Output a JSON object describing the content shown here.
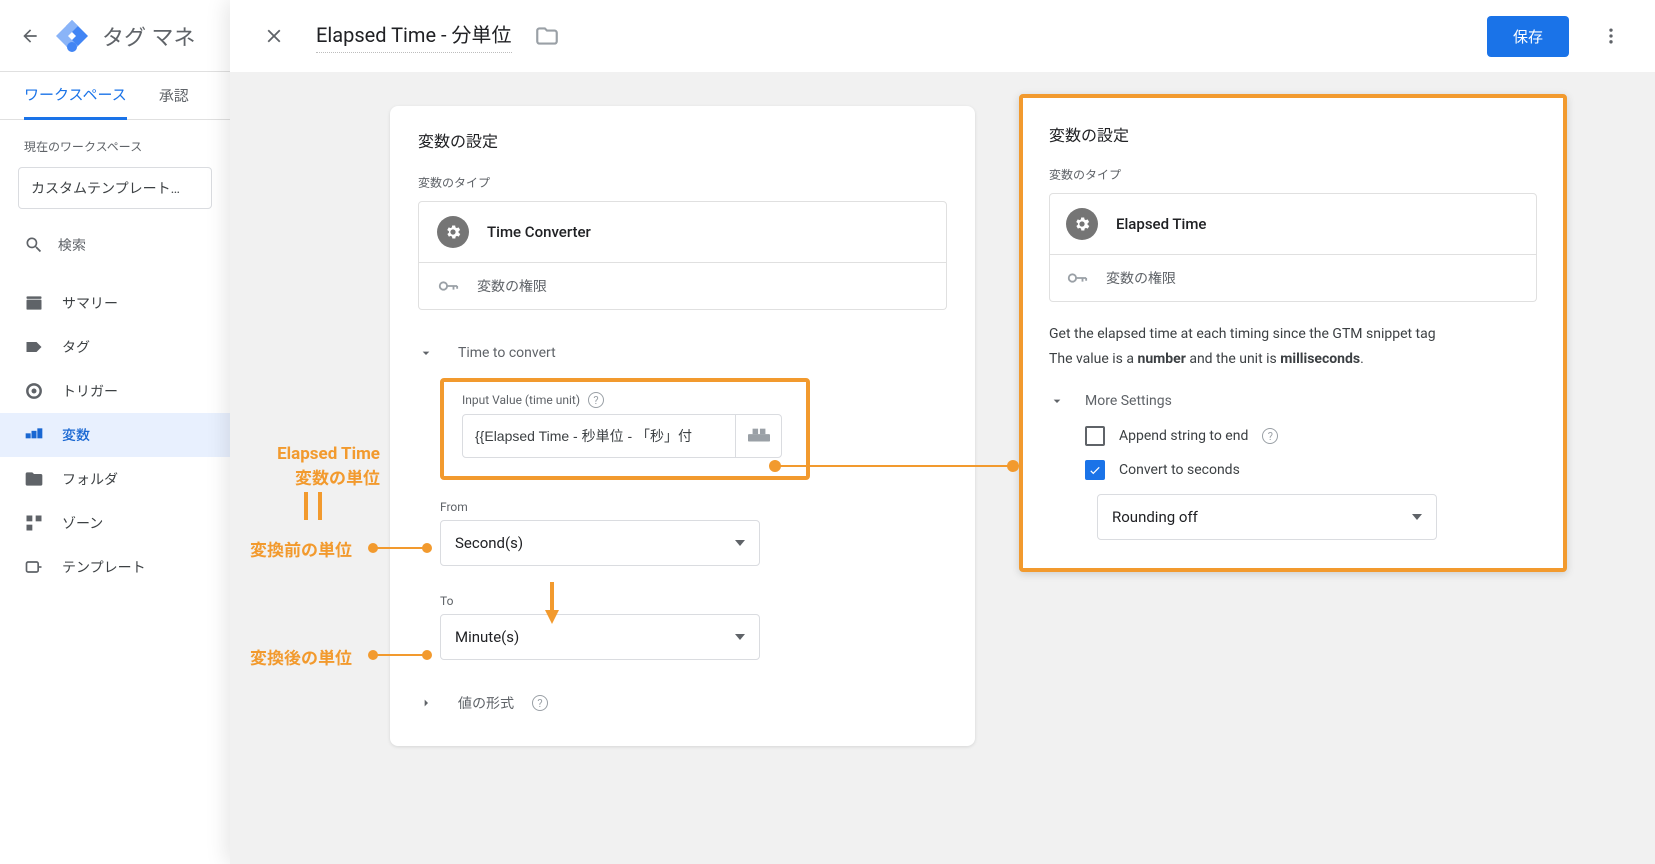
{
  "app": {
    "title": "タグ マネ"
  },
  "tabs": {
    "workspace": "ワークスペース",
    "approvals": "承認"
  },
  "workspace": {
    "label": "現在のワークスペース",
    "current": "カスタムテンプレート…"
  },
  "search": {
    "placeholder": "検索"
  },
  "nav": {
    "summary": "サマリー",
    "tags": "タグ",
    "triggers": "トリガー",
    "variables": "変数",
    "folders": "フォルダ",
    "zones": "ゾーン",
    "templates": "テンプレート"
  },
  "editor": {
    "close_tooltip": "閉じる",
    "name": "Elapsed Time - 分単位",
    "save": "保存",
    "card_title": "変数の設定",
    "type_label": "変数のタイプ",
    "type_name": "Time Converter",
    "permissions": "変数の権限",
    "time_section": "Time to convert",
    "input_label": "Input Value (time unit)",
    "input_value": "{{Elapsed Time - 秒単位 - 「秒」付",
    "from_label": "From",
    "from_value": "Second(s)",
    "to_label": "To",
    "to_value": "Minute(s)",
    "value_format": "値の形式"
  },
  "annotations": {
    "a1": "Elapsed Time",
    "a1b": "変数の単位",
    "a2": "変換前の単位",
    "a3": "変換後の単位"
  },
  "right": {
    "card_title": "変数の設定",
    "type_label": "変数のタイプ",
    "type_name": "Elapsed Time",
    "permissions": "変数の権限",
    "desc_l1_a": "Get the elapsed time at each timing since the GTM snippet tag ",
    "desc_l2_a": "The value is a ",
    "desc_l2_b": "number",
    "desc_l2_c": " and the unit is ",
    "desc_l2_d": "milliseconds",
    "desc_l2_e": ".",
    "more": "More Settings",
    "append": "Append string to end",
    "convert": "Convert to seconds",
    "rounding": "Rounding off"
  }
}
